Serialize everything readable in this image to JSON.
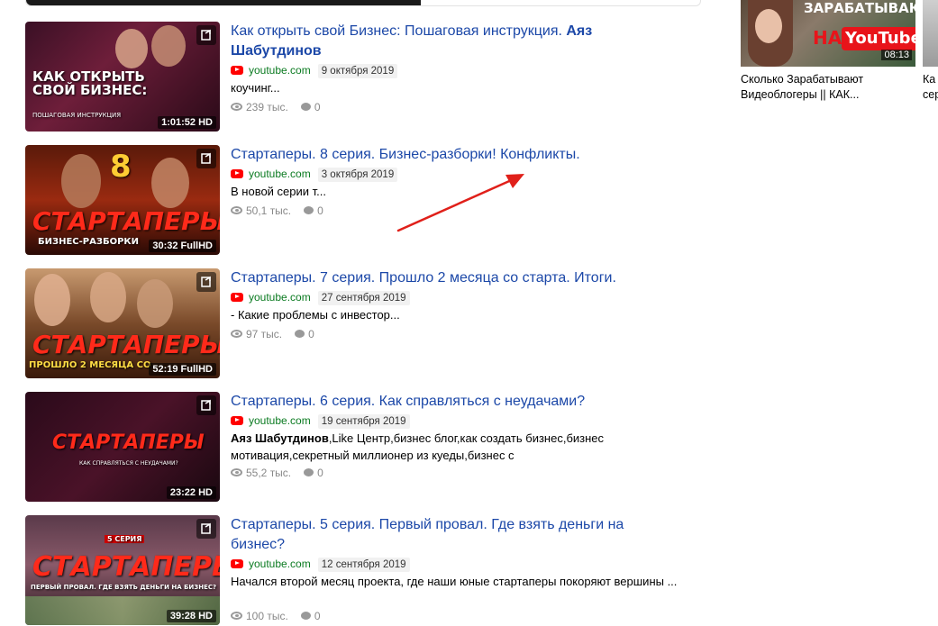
{
  "results": [
    {
      "title": "Как открыть свой Бизнес: Пошаговая инструкция.",
      "title_bold": "Аяз Шабутдинов",
      "domain": "youtube.com",
      "date": "9 октября 2019",
      "description": "коучинг...",
      "views": "239 тыс.",
      "comments": "0",
      "duration": "1:01:52",
      "quality": "HD",
      "thumb_text": "КАК ОТКРЫТЬ СВОЙ БИЗНЕС:",
      "thumb_subtext": "ПОШАГОВАЯ ИНСТРУКЦИЯ"
    },
    {
      "title": "Стартаперы. 8 серия. Бизнес-разборки! Конфликты.",
      "domain": "youtube.com",
      "date": "3 октября 2019",
      "description": "В новой серии т...",
      "views": "50,1 тыс.",
      "comments": "0",
      "duration": "30:32",
      "quality": "FullHD",
      "thumb_text": "СТАРТАПЕРЫ",
      "thumb_subtext": "БИЗНЕС-РАЗБОРКИ",
      "thumb_number": "8"
    },
    {
      "title": "Стартаперы. 7 серия. Прошло 2 месяца со старта. Итоги.",
      "domain": "youtube.com",
      "date": "27 сентября 2019",
      "description": "- Какие проблемы с инвестор...",
      "views": "97 тыс.",
      "comments": "0",
      "duration": "52:19",
      "quality": "FullHD",
      "thumb_text": "СТАРТАПЕРЫ",
      "thumb_subtext": "ПРОШЛО 2 МЕСЯЦА СО"
    },
    {
      "title": "Стартаперы. 6 серия. Как справляться с неудачами?",
      "domain": "youtube.com",
      "date": "19 сентября 2019",
      "description_bold": "Аяз Шабутдинов",
      "description": ",Like Центр,бизнес блог,как создать бизнес,бизнес мотивация,секретный миллионер из куеды,бизнес с",
      "views": "55,2 тыс.",
      "comments": "0",
      "duration": "23:22",
      "quality": "HD",
      "thumb_text": "СТАРТАПЕРЫ",
      "thumb_subtext": "КАК СПРАВЛЯТЬСЯ С НЕУДАЧАМИ?"
    },
    {
      "title": "Стартаперы. 5 серия. Первый провал. Где взять деньги на бизнес?",
      "domain": "youtube.com",
      "date": "12 сентября 2019",
      "description": "Начался второй месяц проекта, где наши юные стартаперы покоряют вершины ...",
      "views": "100 тыс.",
      "comments": "0",
      "duration": "39:28",
      "quality": "HD",
      "thumb_text": "СТАРТАПЕРЫ",
      "thumb_subtext": "ПЕРВЫЙ ПРОВАЛ. ГДЕ ВЗЯТЬ ДЕНЬГИ НА БИЗНЕС?",
      "thumb_label": "5 СЕРИЯ"
    }
  ],
  "side": [
    {
      "title": "Сколько Зарабатывают Видеоблогеры || КАК...",
      "duration": "08:13",
      "thumb_text_top": "ЗАРАБАТЫВАЮТ",
      "thumb_text_na": "НА",
      "thumb_text_yt": "YouTube"
    },
    {
      "title": "Ка\nсер"
    }
  ],
  "colors": {
    "link": "#1c48a8",
    "domain": "#0a7a20",
    "youtube_red": "#ff0000",
    "arrow": "#e0201a"
  }
}
